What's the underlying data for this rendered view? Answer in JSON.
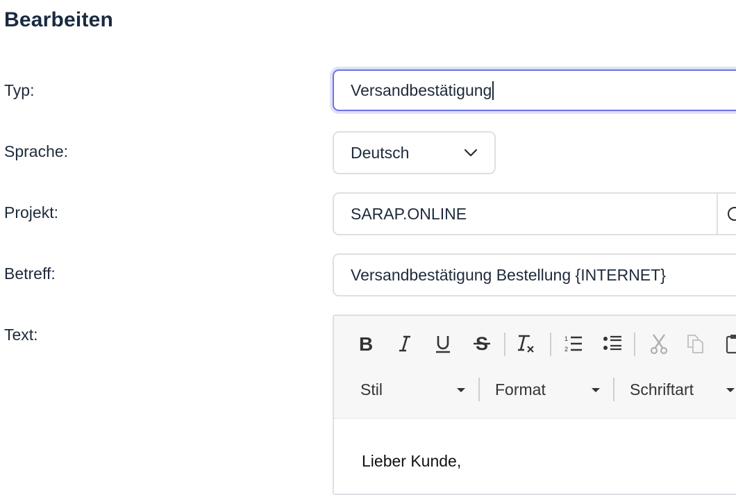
{
  "page": {
    "title": "Bearbeiten"
  },
  "form": {
    "typ": {
      "label": "Typ:",
      "value": "Versandbestätigung"
    },
    "sprache": {
      "label": "Sprache:",
      "value": "Deutsch"
    },
    "projekt": {
      "label": "Projekt:",
      "value": "SARAP.ONLINE"
    },
    "betreff": {
      "label": "Betreff:",
      "value": "Versandbestätigung Bestellung {INTERNET}"
    },
    "text": {
      "label": "Text:"
    }
  },
  "editor": {
    "toolbar": {
      "buttons": [
        "bold-icon",
        "italic-icon",
        "underline-icon",
        "strikethrough-icon",
        "remove-format-icon",
        "numbered-list-icon",
        "bulleted-list-icon",
        "cut-icon",
        "copy-icon",
        "paste-icon"
      ],
      "combos": {
        "stil": "Stil",
        "format": "Format",
        "schriftart": "Schriftart"
      }
    },
    "content": "Lieber Kunde,"
  },
  "colors": {
    "focus_border": "#6c71e8",
    "focus_ring": "#dfe1fa",
    "field_border": "#dcdfe4",
    "title": "#1b2a41"
  }
}
